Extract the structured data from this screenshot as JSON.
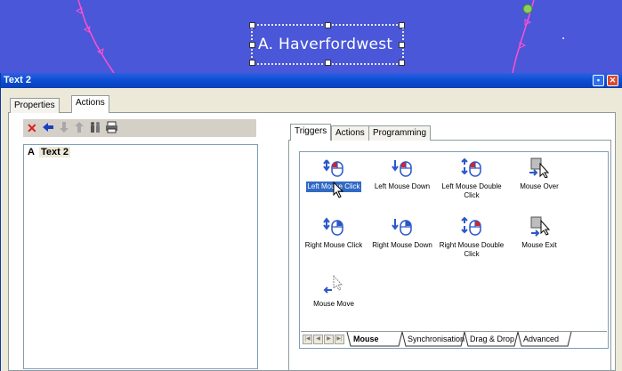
{
  "canvas": {
    "label_text": "A. Haverfordwest"
  },
  "window": {
    "title": "Text 2",
    "minimize_glyph": "▪",
    "close_glyph": "✕"
  },
  "tabs": {
    "properties": "Properties",
    "actions": "Actions"
  },
  "toolbar": {
    "delete_icon": "delete-icon",
    "back_icon": "back-arrow-icon",
    "down_icon": "move-down-icon",
    "up_icon": "move-up-icon",
    "people_icon": "people-icon",
    "print_icon": "print-icon"
  },
  "list": {
    "items": [
      {
        "letter": "A",
        "text": "Text 2"
      }
    ]
  },
  "right_tabs": {
    "triggers": "Triggers",
    "actions": "Actions",
    "programming": "Programming"
  },
  "triggers": {
    "left_click": "Left Mouse Click",
    "left_down": "Left Mouse Down",
    "left_double": "Left Mouse Double Click",
    "mouse_over": "Mouse Over",
    "right_click": "Right Mouse Click",
    "right_down": "Right Mouse Down",
    "right_double": "Right Mouse Double Click",
    "mouse_exit": "Mouse Exit",
    "mouse_move": "Mouse Move",
    "selected": "Left Mouse Click"
  },
  "bottom_tabs": {
    "mouse": "Mouse",
    "synchronisation": "Synchronisation",
    "drag_drop": "Drag & Drop",
    "advanced": "Advanced"
  },
  "colors": {
    "canvas_blue": "#4a57d8",
    "title_blue": "#0a4ed5",
    "selection_blue": "#316ac5",
    "mouse_red": "#e02020",
    "mouse_blue": "#2b57c8"
  }
}
